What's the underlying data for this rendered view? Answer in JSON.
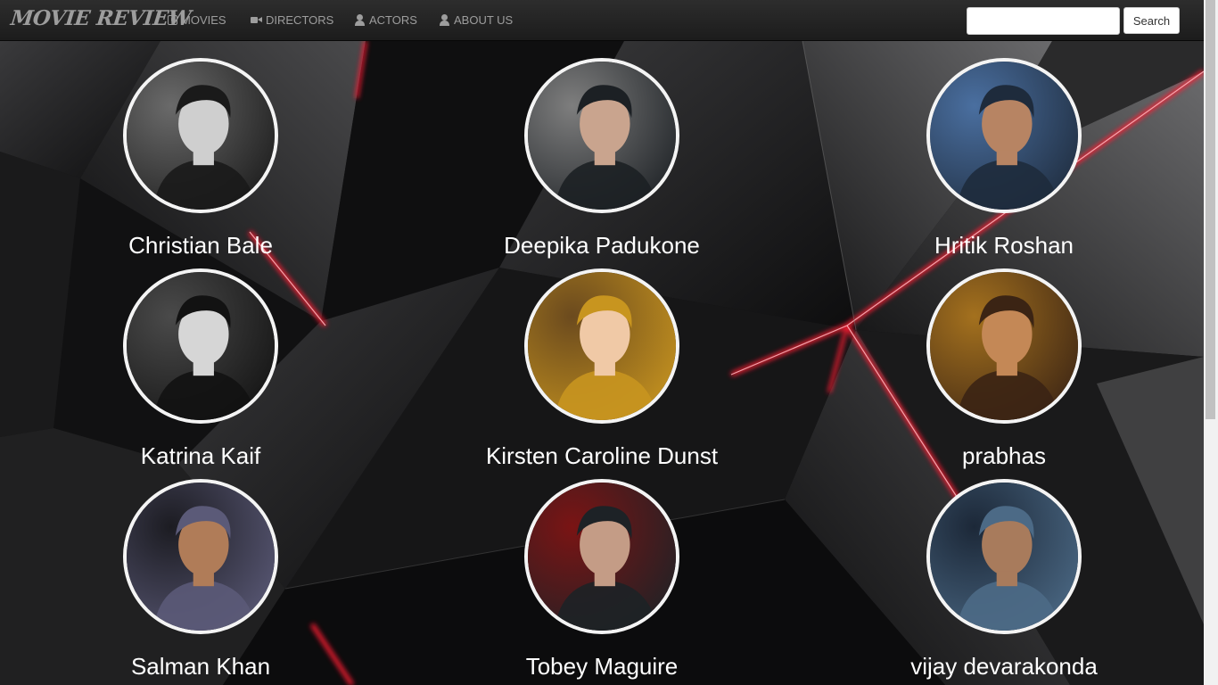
{
  "navbar": {
    "brand": "MOVIE REVIEW",
    "links": [
      {
        "label": "MOVIES",
        "icon": "play-icon"
      },
      {
        "label": "DIRECTORS",
        "icon": "video-camera-icon"
      },
      {
        "label": "ACTORS",
        "icon": "user-icon"
      },
      {
        "label": "ABOUT US",
        "icon": "user-icon"
      }
    ],
    "search": {
      "value": "",
      "placeholder": "",
      "button_label": "Search"
    }
  },
  "actors": [
    {
      "name": "Christian Bale",
      "palette": [
        "#1a1a1a",
        "#cfcfcf",
        "#6a6a6a"
      ]
    },
    {
      "name": "Deepika Padukone",
      "palette": [
        "#1c2024",
        "#c9a48e",
        "#7e7e7e"
      ]
    },
    {
      "name": "Hritik Roshan",
      "palette": [
        "#1e2b3c",
        "#b78463",
        "#4a6fa0"
      ]
    },
    {
      "name": "Katrina Kaif",
      "palette": [
        "#121212",
        "#d6d6d6",
        "#4a4a4a"
      ]
    },
    {
      "name": "Kirsten Caroline Dunst",
      "palette": [
        "#c8951f",
        "#f0c9a6",
        "#6b4a1e"
      ]
    },
    {
      "name": "prabhas",
      "palette": [
        "#3b2414",
        "#c48856",
        "#a4711e"
      ]
    },
    {
      "name": "Salman Khan",
      "palette": [
        "#5b5a78",
        "#b07c58",
        "#1c1c22"
      ]
    },
    {
      "name": "Tobey Maguire",
      "palette": [
        "#1d2226",
        "#c49c86",
        "#7a1414"
      ]
    },
    {
      "name": "vijay devarakonda",
      "palette": [
        "#4c6a86",
        "#a87b5c",
        "#1c2838"
      ]
    }
  ],
  "theme": {
    "accent": "#e0152a",
    "text": "#ffffff",
    "nav_text": "#9d9d9d"
  }
}
